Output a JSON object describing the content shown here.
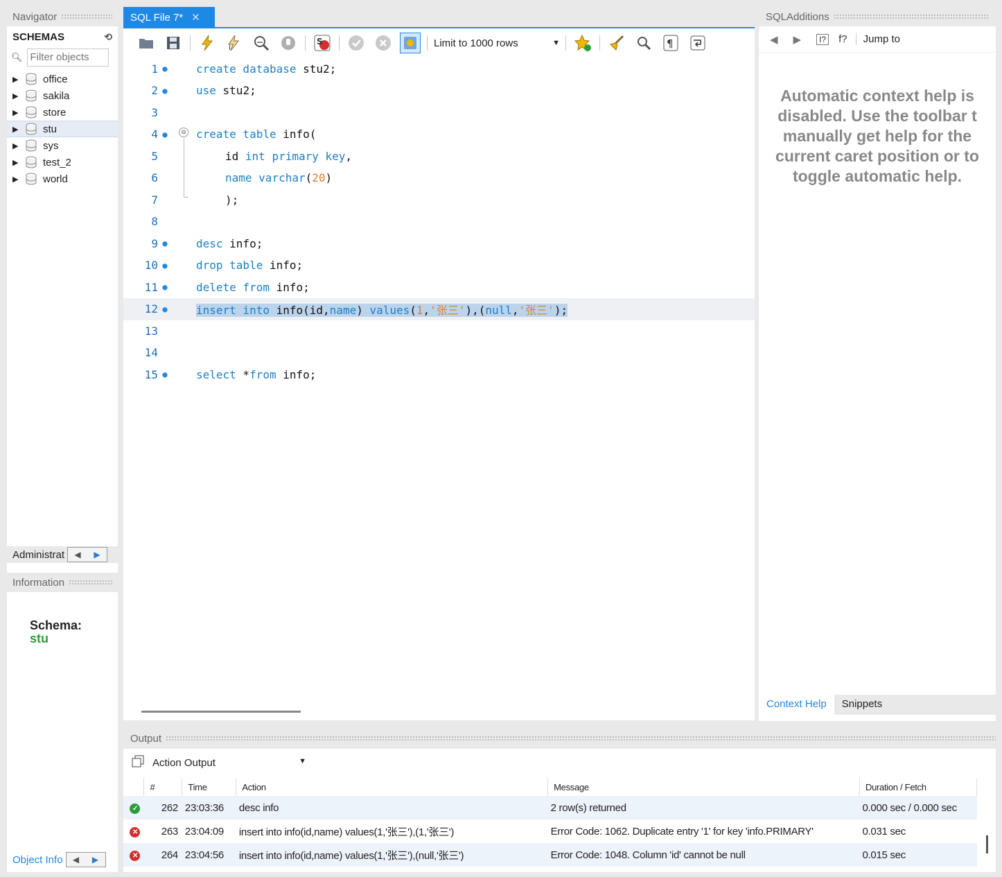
{
  "navigator": {
    "title": "Navigator",
    "schemas_label": "SCHEMAS",
    "filter_placeholder": "Filter objects",
    "schemas": [
      "office",
      "sakila",
      "store",
      "stu",
      "sys",
      "test_2",
      "world"
    ],
    "selected_schema": "stu",
    "admin_tab": "Administrat",
    "info_title": "Information",
    "schema_label": "Schema:",
    "schema_value": "stu",
    "object_info_tab": "Object Info"
  },
  "editor": {
    "tab_title": "SQL File 7*",
    "limit_label": "Limit to 1000 rows",
    "lines": [
      {
        "n": "1",
        "dot": true
      },
      {
        "n": "2",
        "dot": true
      },
      {
        "n": "3",
        "dot": false
      },
      {
        "n": "4",
        "dot": true
      },
      {
        "n": "5",
        "dot": false
      },
      {
        "n": "6",
        "dot": false
      },
      {
        "n": "7",
        "dot": false
      },
      {
        "n": "8",
        "dot": false
      },
      {
        "n": "9",
        "dot": true
      },
      {
        "n": "10",
        "dot": true
      },
      {
        "n": "11",
        "dot": true
      },
      {
        "n": "12",
        "dot": true
      },
      {
        "n": "13",
        "dot": false
      },
      {
        "n": "14",
        "dot": false
      },
      {
        "n": "15",
        "dot": true
      }
    ],
    "code": {
      "l1": [
        "create database",
        " stu2;"
      ],
      "l2": [
        "use",
        " stu2;"
      ],
      "l4": [
        "create table",
        " info("
      ],
      "l5": [
        "id ",
        "int primary key",
        ","
      ],
      "l6": [
        "name",
        " ",
        "varchar",
        "(",
        "20",
        ")"
      ],
      "l7": ");",
      "l9": [
        "desc",
        " info;"
      ],
      "l10": [
        "drop table",
        " info;"
      ],
      "l11": [
        "delete from",
        " info;"
      ],
      "l12": [
        "insert into",
        " info(id,",
        "name",
        ") ",
        "values",
        "(",
        "1",
        ",",
        "'张三'",
        "),(",
        "null",
        ",",
        "'张三'",
        ");"
      ],
      "l15": [
        "select",
        " *",
        "from",
        " info;"
      ]
    }
  },
  "sql_additions": {
    "title": "SQLAdditions",
    "jump_to": "Jump to",
    "help_text": "Automatic context help is\ndisabled. Use the toolbar t\nmanually get help for the\ncurrent caret position or to\ntoggle automatic help.",
    "tabs": [
      "Context Help",
      "Snippets"
    ]
  },
  "output": {
    "title": "Output",
    "selector": "Action Output",
    "columns": [
      "#",
      "Time",
      "Action",
      "Message",
      "Duration / Fetch"
    ],
    "rows": [
      {
        "status": "ok",
        "num": "262",
        "time": "23:03:36",
        "action": "desc info",
        "message": "2 row(s) returned",
        "duration": "0.000 sec / 0.000 sec"
      },
      {
        "status": "error",
        "num": "263",
        "time": "23:04:09",
        "action": "insert into info(id,name) values(1,'张三'),(1,'张三')",
        "message": "Error Code: 1062. Duplicate entry '1' for key 'info.PRIMARY'",
        "duration": "0.031 sec"
      },
      {
        "status": "error",
        "num": "264",
        "time": "23:04:56",
        "action": "insert into info(id,name) values(1,'张三'),(null,'张三')",
        "message": "Error Code: 1048. Column 'id' cannot be null",
        "duration": "0.015 sec"
      }
    ]
  },
  "colors": {
    "accent": "#1e88e5",
    "keyword": "#1c7fc4",
    "number": "#e07b2e",
    "ok": "#2a9d3a",
    "error": "#d32f2f",
    "selection": "#bcd3ec"
  }
}
